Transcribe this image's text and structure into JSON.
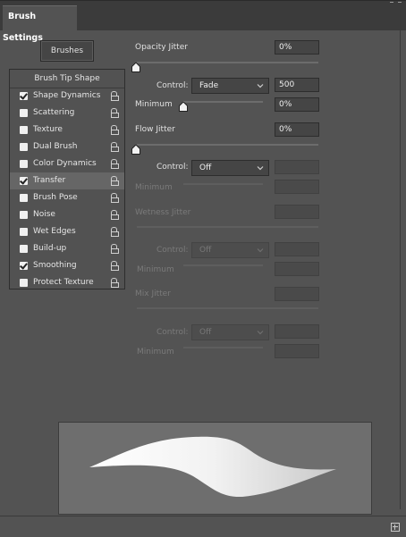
{
  "panel": {
    "tab_title": "Brush Settings"
  },
  "buttons": {
    "brushes": "Brushes"
  },
  "list": {
    "brush_tip_shape": "Brush Tip Shape",
    "items": [
      {
        "label": "Shape Dynamics",
        "checked": true,
        "selected": false
      },
      {
        "label": "Scattering",
        "checked": false,
        "selected": false
      },
      {
        "label": "Texture",
        "checked": false,
        "selected": false
      },
      {
        "label": "Dual Brush",
        "checked": false,
        "selected": false
      },
      {
        "label": "Color Dynamics",
        "checked": false,
        "selected": false
      },
      {
        "label": "Transfer",
        "checked": true,
        "selected": true
      },
      {
        "label": "Brush Pose",
        "checked": false,
        "selected": false
      },
      {
        "label": "Noise",
        "checked": false,
        "selected": false
      },
      {
        "label": "Wet Edges",
        "checked": false,
        "selected": false
      },
      {
        "label": "Build-up",
        "checked": false,
        "selected": false
      },
      {
        "label": "Smoothing",
        "checked": true,
        "selected": false
      },
      {
        "label": "Protect Texture",
        "checked": false,
        "selected": false
      }
    ]
  },
  "opacity": {
    "label": "Opacity Jitter",
    "value": "0%",
    "control_label": "Control:",
    "control_value": "Fade",
    "fade_steps": "500",
    "minimum_label": "Minimum",
    "minimum_value": "0%"
  },
  "flow": {
    "label": "Flow Jitter",
    "value": "0%",
    "control_label": "Control:",
    "control_value": "Off",
    "minimum_label": "Minimum"
  },
  "wetness": {
    "label": "Wetness Jitter",
    "control_label": "Control:",
    "control_value": "Off",
    "minimum_label": "Minimum"
  },
  "mix": {
    "label": "Mix Jitter",
    "control_label": "Control:",
    "control_value": "Off",
    "minimum_label": "Minimum"
  },
  "colors": {
    "panel_bg": "#535353",
    "field_bg": "#454545",
    "preview_bg": "#6e6e6e"
  }
}
